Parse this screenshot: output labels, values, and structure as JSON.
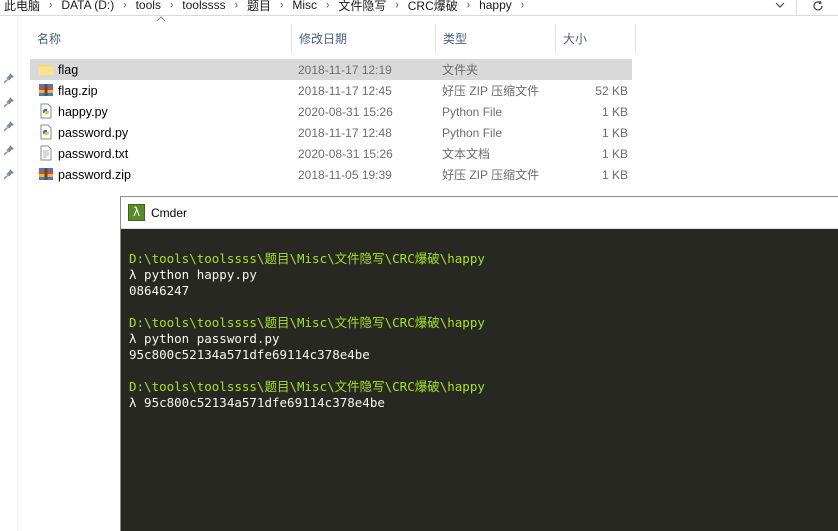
{
  "breadcrumb": {
    "items": [
      "此电脑",
      "DATA (D:)",
      "tools",
      "toolssss",
      "题目",
      "Misc",
      "文件隐写",
      "CRC爆破",
      "happy"
    ],
    "separator": "›"
  },
  "columns": {
    "name": "名称",
    "date": "修改日期",
    "type": "类型",
    "size": "大小"
  },
  "files": [
    {
      "name": "flag",
      "date": "2018-11-17 12:19",
      "type": "文件夹",
      "size": "",
      "icon": "folder-icon",
      "selected": true
    },
    {
      "name": "flag.zip",
      "date": "2018-11-17 12:45",
      "type": "好压 ZIP 压缩文件",
      "size": "52 KB",
      "icon": "zip-archive-icon"
    },
    {
      "name": "happy.py",
      "date": "2020-08-31 15:26",
      "type": "Python File",
      "size": "1 KB",
      "icon": "python-file-icon"
    },
    {
      "name": "password.py",
      "date": "2018-11-17 12:48",
      "type": "Python File",
      "size": "1 KB",
      "icon": "python-file-icon"
    },
    {
      "name": "password.txt",
      "date": "2020-08-31 15:26",
      "type": "文本文档",
      "size": "1 KB",
      "icon": "text-file-icon"
    },
    {
      "name": "password.zip",
      "date": "2018-11-05 19:39",
      "type": "好压 ZIP 压缩文件",
      "size": "1 KB",
      "icon": "zip-archive-icon"
    }
  ],
  "cmder": {
    "title": "Cmder",
    "logo": "λ",
    "lines": [
      {
        "kind": "path",
        "text": "D:\\tools\\toolssss\\题目\\Misc\\文件隐写\\CRC爆破\\happy"
      },
      {
        "kind": "cmd",
        "text": "λ python happy.py"
      },
      {
        "kind": "out",
        "text": "08646247"
      },
      {
        "kind": "blank",
        "text": ""
      },
      {
        "kind": "path",
        "text": "D:\\tools\\toolssss\\题目\\Misc\\文件隐写\\CRC爆破\\happy"
      },
      {
        "kind": "cmd",
        "text": "λ python password.py"
      },
      {
        "kind": "out",
        "text": "95c800c52134a571dfe69114c378e4be"
      },
      {
        "kind": "blank",
        "text": ""
      },
      {
        "kind": "path",
        "text": "D:\\tools\\toolssss\\题目\\Misc\\文件隐写\\CRC爆破\\happy"
      },
      {
        "kind": "cmd",
        "text": "λ 95c800c52134a571dfe69114c378e4be"
      }
    ]
  },
  "colors": {
    "terminal_bg": "#272822",
    "prompt_path": "#a6e22e",
    "terminal_text": "#f8f8f2",
    "selection": "#d9d9d9"
  }
}
